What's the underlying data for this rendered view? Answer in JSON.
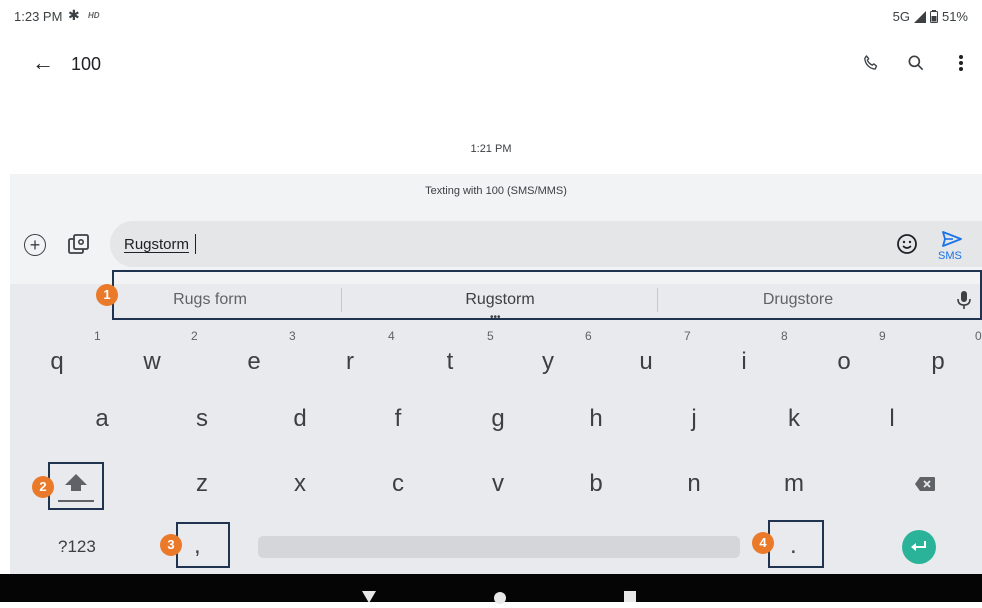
{
  "status_bar": {
    "time": "1:23 PM",
    "hd_label": "HD",
    "signal_text": "5G",
    "battery": "51%",
    "icons": [
      "gear-icon",
      "signal-icon",
      "battery-icon"
    ]
  },
  "header": {
    "title": "100",
    "icons": [
      "back-arrow-icon",
      "phone-icon",
      "search-icon",
      "more-vert-icon"
    ]
  },
  "conversation": {
    "timestamp": "1:21 PM",
    "banner": "Texting with 100 (SMS/MMS)"
  },
  "compose": {
    "text": "Rugstorm",
    "send_label": "SMS",
    "icons": [
      "add-icon",
      "gallery-icon",
      "emoji-icon",
      "send-icon"
    ]
  },
  "suggestions": [
    "Rugs form",
    "Rugstorm",
    "Drugstore"
  ],
  "keyboard": {
    "row1": [
      {
        "key": "q",
        "hint": "1"
      },
      {
        "key": "w",
        "hint": "2"
      },
      {
        "key": "e",
        "hint": "3"
      },
      {
        "key": "r",
        "hint": "4"
      },
      {
        "key": "t",
        "hint": "5"
      },
      {
        "key": "y",
        "hint": "6"
      },
      {
        "key": "u",
        "hint": "7"
      },
      {
        "key": "i",
        "hint": "8"
      },
      {
        "key": "o",
        "hint": "9"
      },
      {
        "key": "p",
        "hint": "0"
      }
    ],
    "row2": [
      "a",
      "s",
      "d",
      "f",
      "g",
      "h",
      "j",
      "k",
      "l"
    ],
    "row3": [
      "z",
      "x",
      "c",
      "v",
      "b",
      "n",
      "m"
    ],
    "symbols_key": "?123",
    "comma_key": ",",
    "period_key": "."
  },
  "annotations": [
    "1",
    "2",
    "3",
    "4"
  ],
  "colors": {
    "accent": "#1a73e8",
    "enter_key": "#2bb39a",
    "annotation_fill": "#ea7a2a",
    "annotation_box": "#20344f",
    "keyboard_bg": "#e8eaed"
  }
}
